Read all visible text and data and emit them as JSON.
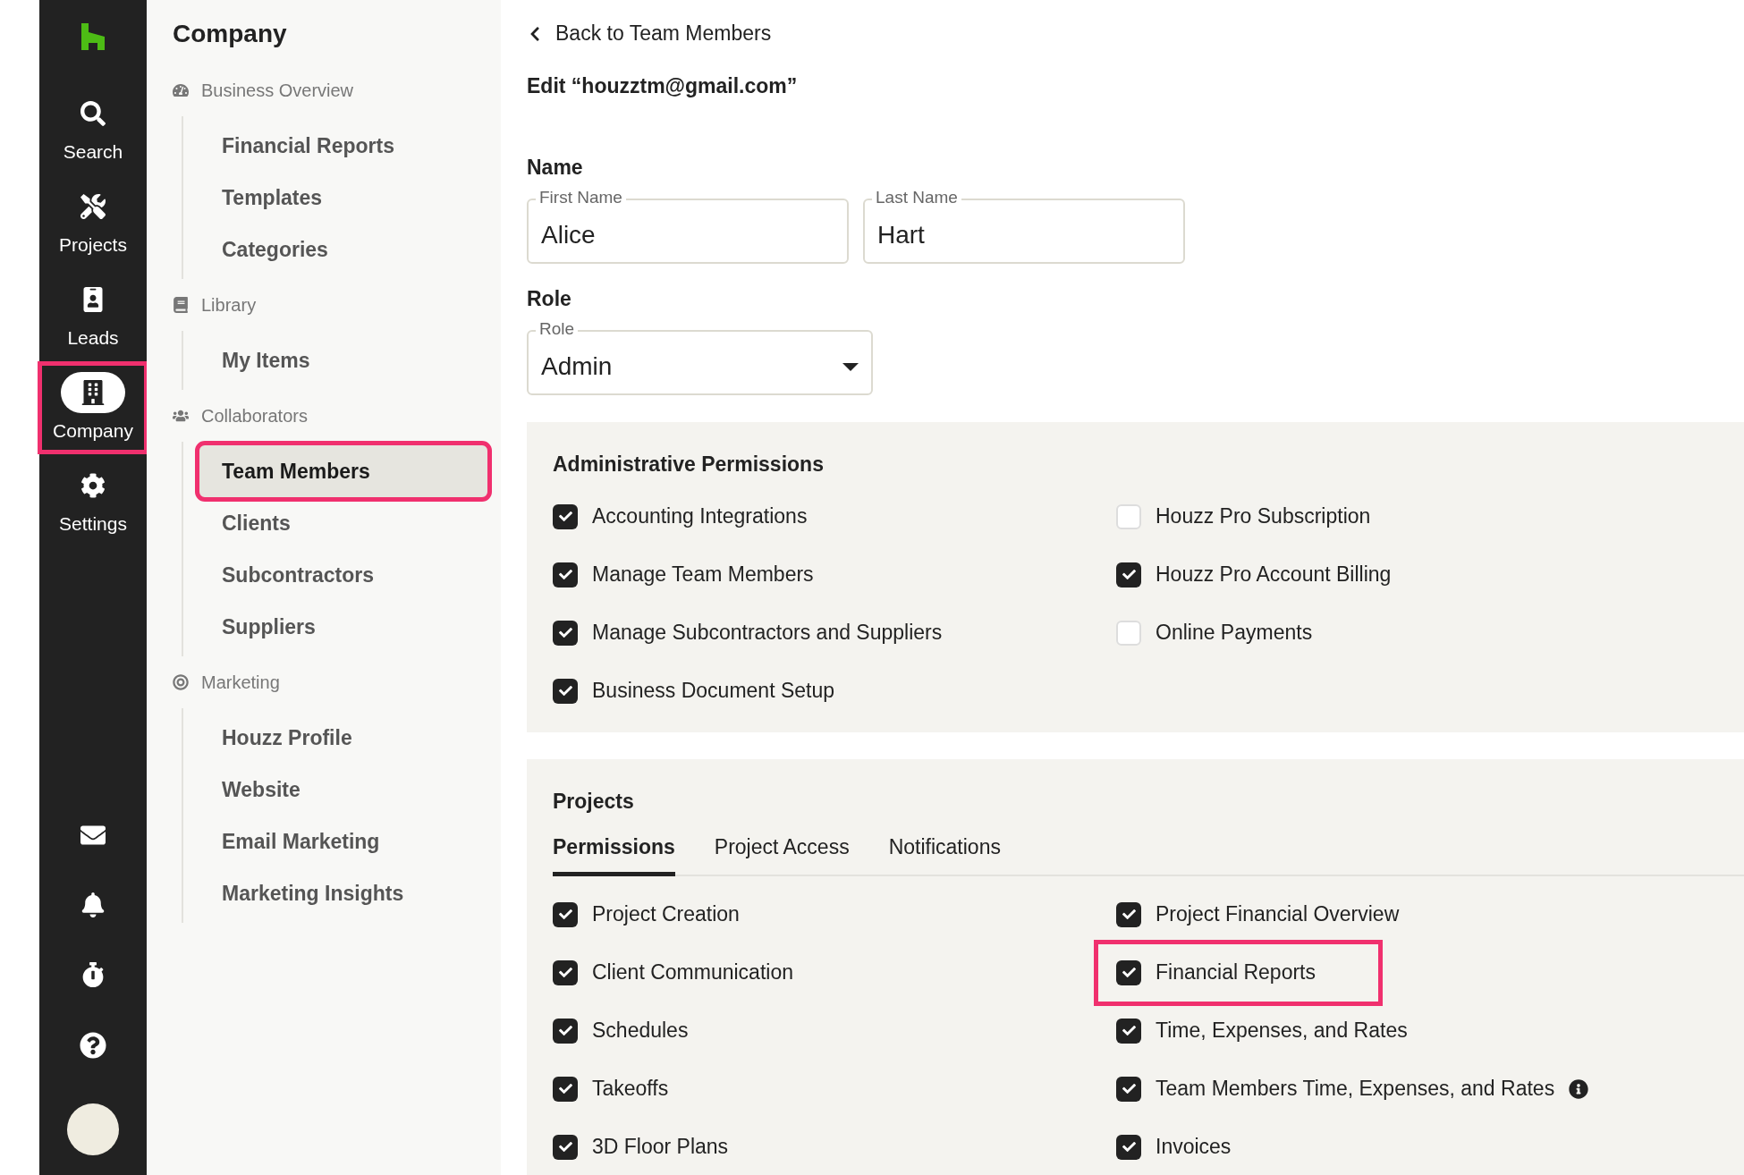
{
  "rail": {
    "items": [
      {
        "label": "Search",
        "selected": false,
        "highlighted": false
      },
      {
        "label": "Projects",
        "selected": false,
        "highlighted": false
      },
      {
        "label": "Leads",
        "selected": false,
        "highlighted": false
      },
      {
        "label": "Company",
        "selected": true,
        "highlighted": true
      },
      {
        "label": "Settings",
        "selected": false,
        "highlighted": false
      }
    ]
  },
  "sidebar": {
    "title": "Company",
    "sections": [
      {
        "title": "Business Overview",
        "items": [
          {
            "label": "Financial Reports",
            "selected": false,
            "highlighted": false
          },
          {
            "label": "Templates",
            "selected": false,
            "highlighted": false
          },
          {
            "label": "Categories",
            "selected": false,
            "highlighted": false
          }
        ]
      },
      {
        "title": "Library",
        "items": [
          {
            "label": "My Items",
            "selected": false,
            "highlighted": false
          }
        ]
      },
      {
        "title": "Collaborators",
        "items": [
          {
            "label": "Team Members",
            "selected": true,
            "highlighted": true
          },
          {
            "label": "Clients",
            "selected": false,
            "highlighted": false
          },
          {
            "label": "Subcontractors",
            "selected": false,
            "highlighted": false
          },
          {
            "label": "Suppliers",
            "selected": false,
            "highlighted": false
          }
        ]
      },
      {
        "title": "Marketing",
        "items": [
          {
            "label": "Houzz Profile",
            "selected": false,
            "highlighted": false
          },
          {
            "label": "Website",
            "selected": false,
            "highlighted": false
          },
          {
            "label": "Email Marketing",
            "selected": false,
            "highlighted": false
          },
          {
            "label": "Marketing Insights",
            "selected": false,
            "highlighted": false
          }
        ]
      }
    ]
  },
  "main": {
    "back_link": "Back to Team Members",
    "heading": "Edit “houzztm@gmail.com”",
    "name_section": {
      "title": "Name",
      "fields": [
        {
          "label": "First Name",
          "value": "Alice"
        },
        {
          "label": "Last Name",
          "value": "Hart"
        }
      ]
    },
    "role_section": {
      "title": "Role",
      "select": {
        "label": "Role",
        "value": "Admin"
      }
    },
    "admin_permissions": {
      "title": "Administrative Permissions",
      "items": [
        {
          "label": "Accounting Integrations",
          "checked": true,
          "highlighted": false,
          "info": false
        },
        {
          "label": "Houzz Pro Subscription",
          "checked": false,
          "highlighted": false,
          "info": false
        },
        {
          "label": "Manage Team Members",
          "checked": true,
          "highlighted": false,
          "info": false
        },
        {
          "label": "Houzz Pro Account Billing",
          "checked": true,
          "highlighted": false,
          "info": false
        },
        {
          "label": "Manage Subcontractors and Suppliers",
          "checked": true,
          "highlighted": false,
          "info": false
        },
        {
          "label": "Online Payments",
          "checked": false,
          "highlighted": false,
          "info": false
        },
        {
          "label": "Business Document Setup",
          "checked": true,
          "highlighted": false,
          "info": false
        }
      ]
    },
    "projects": {
      "title": "Projects",
      "tabs": [
        {
          "label": "Permissions",
          "selected": true
        },
        {
          "label": "Project Access",
          "selected": false
        },
        {
          "label": "Notifications",
          "selected": false
        }
      ],
      "items": [
        {
          "label": "Project Creation",
          "checked": true,
          "highlighted": false,
          "info": false
        },
        {
          "label": "Project Financial Overview",
          "checked": true,
          "highlighted": false,
          "info": false
        },
        {
          "label": "Client Communication",
          "checked": true,
          "highlighted": false,
          "info": false
        },
        {
          "label": "Financial Reports",
          "checked": true,
          "highlighted": true,
          "info": false
        },
        {
          "label": "Schedules",
          "checked": true,
          "highlighted": false,
          "info": false
        },
        {
          "label": "Time, Expenses, and Rates",
          "checked": true,
          "highlighted": false,
          "info": false
        },
        {
          "label": "Takeoffs",
          "checked": true,
          "highlighted": false,
          "info": false
        },
        {
          "label": "Team Members Time, Expenses, and Rates",
          "checked": true,
          "highlighted": false,
          "info": true
        },
        {
          "label": "3D Floor Plans",
          "checked": true,
          "highlighted": false,
          "info": false
        },
        {
          "label": "Invoices",
          "checked": true,
          "highlighted": false,
          "info": false
        }
      ]
    }
  }
}
